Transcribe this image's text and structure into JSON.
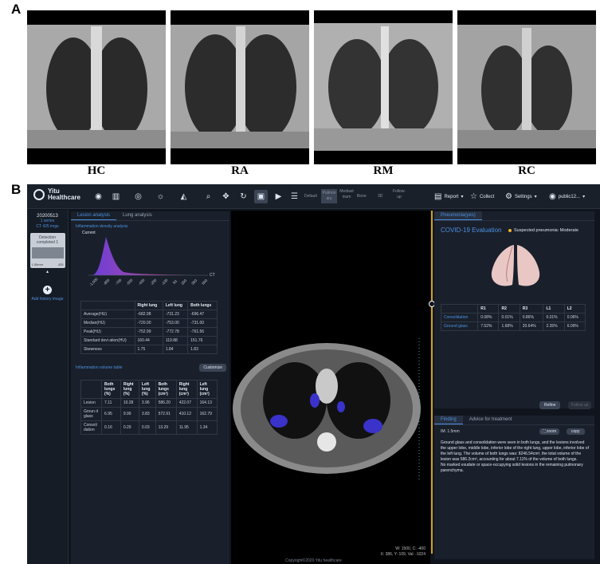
{
  "figure": {
    "panel_a_label": "A",
    "panel_b_label": "B",
    "scans": [
      {
        "label": "HC"
      },
      {
        "label": "RA"
      },
      {
        "label": "RM"
      },
      {
        "label": "RC"
      }
    ]
  },
  "app": {
    "logo_line1": "Yitu",
    "logo_line2": "Healthcare",
    "window_presets": [
      "Default",
      "Pulmon ary",
      "Mediast inum",
      "Bone"
    ],
    "mode_3d": "3D",
    "followup": "Follow- up",
    "report_label": "Report",
    "collect_label": "Collect",
    "settings_label": "Settings",
    "user_label": "public12...",
    "copyright": "Copyright©2020 Yitu healthcare"
  },
  "rail": {
    "date": "20200513",
    "series": "1 series",
    "images": "CT 425 imgs",
    "detection": "Detection completed",
    "detection_count": "1",
    "thumb_thickness": "1.50mm",
    "thumb_count": "425",
    "add_label": "Add history image"
  },
  "lesion": {
    "tabs": [
      "Lesion analysis",
      "Lung analysis"
    ],
    "density_title": "Inflammation density analysis",
    "current_label": "Current",
    "ct_axis_label": "CT",
    "x_ticks": [
      "-1,000",
      "-850",
      "-700",
      "-550",
      "-400",
      "-250",
      "-100",
      "50",
      "200",
      "350",
      "500"
    ],
    "stats_headers": [
      "",
      "Right lung",
      "Left lung",
      "Both lungs"
    ],
    "stats_rows": [
      [
        "Average(HU)",
        "-682.98",
        "-731.23",
        "-696.47"
      ],
      [
        "Median(HU)",
        "-720.00",
        "-753.00",
        "-731.00"
      ],
      [
        "Peak(HU)",
        "-752.99",
        "-772.78",
        "-761.56"
      ],
      [
        "Standard devi ation(HU)",
        "160.44",
        "119.88",
        "151.76"
      ],
      [
        "Skewness",
        "1.75",
        "1.84",
        "1.83"
      ]
    ],
    "volume_title": "Inflammation volume table",
    "customize_label": "Customize",
    "volume_headers": [
      "",
      "Both lungs (%)",
      "Right lung (%)",
      "Left lung (%)",
      "Both lungs (cm³)",
      "Right lung (cm³)",
      "Left lung (cm³)"
    ],
    "volume_rows": [
      [
        "Lesion",
        "7.11",
        "10.28",
        "3.96",
        "586.20",
        "422.07",
        "164.13"
      ],
      [
        "Groun d glass",
        "6.95",
        "9.99",
        "3.83",
        "572.91",
        "410.12",
        "162.79"
      ],
      [
        "Consoli dation",
        "0.16",
        "0.29",
        "0.03",
        "13.29",
        "11.95",
        "1.34"
      ]
    ]
  },
  "viewer": {
    "wc_line": "W: 1500, C: -400",
    "pos_line": "X: 386, Y: 109, Val: -1024"
  },
  "pneumonia": {
    "tab": "Pneumonia(yes)",
    "title": "COVID-19 Evaluation",
    "badge": "Suspected pneumonia: Moderate",
    "table_headers": [
      "",
      "R1",
      "R2",
      "R3",
      "L1",
      "L2"
    ],
    "table_rows": [
      [
        "Consolidation",
        "0.08%",
        "0.01%",
        "0.86%",
        "0.01%",
        "0.06%"
      ],
      [
        "Ground glass",
        "7.52%",
        "1.68%",
        "20.64%",
        "2.35%",
        "6.09%"
      ]
    ],
    "refine_label": "Refine",
    "followup_label": "Follow up"
  },
  "finding": {
    "tabs": [
      "Finding",
      "Advice for treatment"
    ],
    "im_label": "IM: 1.5mm",
    "zoom_label": "zoom",
    "copy_label": "copy",
    "text": "Ground glass and consolidation were seen in both lungs, and the lesions involved the upper lobe, middle lobe, inferior lobe of the right lung, upper lobe, inferior lobe of the left lung. The volume of both lungs was: 8246.54cm³, the total volume of the lesion was 586.2cm³, accounting for about 7.11% of the volume of both lungs.",
    "text2": "No marked exudate or space-occupying solid lesions in the remaining pulmonary parenchyma."
  }
}
